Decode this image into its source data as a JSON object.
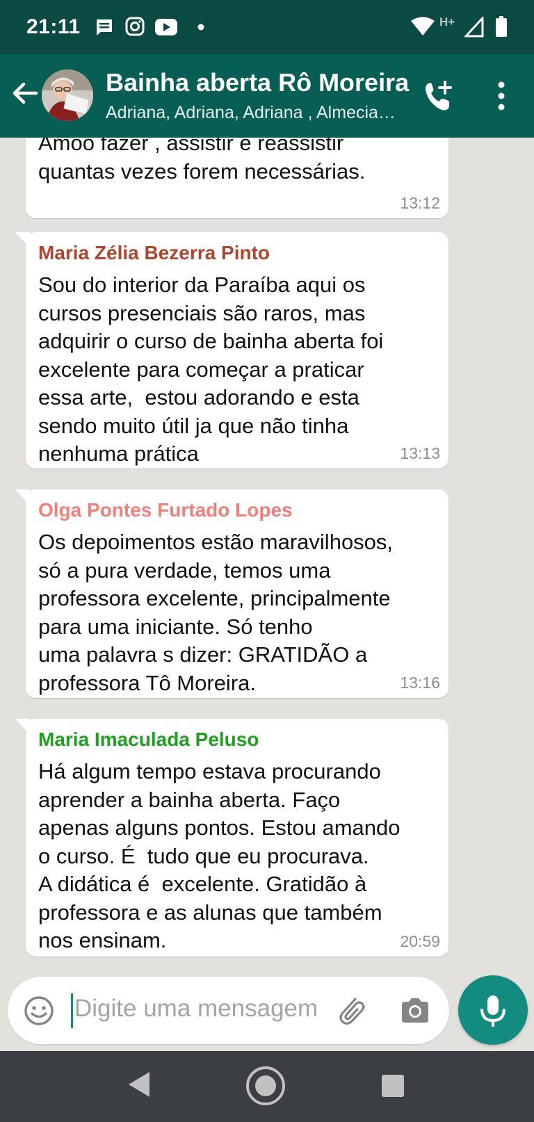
{
  "status_bar": {
    "time": "21:11",
    "network_label": "H+",
    "icons": [
      "message-notification-icon",
      "instagram-icon",
      "youtube-icon",
      "dot-icon",
      "wifi-icon",
      "signal-icon",
      "battery-icon"
    ]
  },
  "header": {
    "title": "Bainha aberta Rô Moreira",
    "subtitle": "Adriana, Adriana, Adriana , Almeciana, Ana",
    "icons": [
      "back-arrow-icon",
      "group-avatar",
      "add-call-icon",
      "more-vert-icon"
    ]
  },
  "messages": [
    {
      "sender": "",
      "sender_color": "",
      "text": "Amoo fazer , assistir e reassistir\nquantas vezes forem necessárias.",
      "time": "13:12"
    },
    {
      "sender": "Maria Zélia Bezerra Pinto",
      "sender_color": "#b0452e",
      "text": "Sou do interior da Paraíba aqui os\ncursos presenciais são raros, mas\nadquirir o curso de bainha aberta foi\nexcelente para começar a praticar\nessa arte,  estou adorando e esta\nsendo muito útil ja que não tinha\nnenhuma prática",
      "time": "13:13"
    },
    {
      "sender": "Olga Pontes Furtado Lopes",
      "sender_color": "#f2807a",
      "text": "Os depoimentos estão maravilhosos,\nsó a pura verdade, temos uma\nprofessora excelente, principalmente\npara uma iniciante. Só tenho\numa palavra s dizer: GRATIDÃO a\nprofessora Tô Moreira.",
      "time": "13:16"
    },
    {
      "sender": "Maria Imaculada Peluso",
      "sender_color": "#1ea21e",
      "text": "Há algum tempo estava procurando\naprender a bainha aberta. Faço\napenas alguns pontos. Estou amando\no curso. É  tudo que eu procurava.\nA didática é  excelente. Gratidão à\nprofessora e as alunas que também\nnos ensinam.",
      "time": "20:59"
    }
  ],
  "composer": {
    "placeholder": "Digite uma mensagem",
    "icons": [
      "emoji-icon",
      "attach-icon",
      "camera-icon",
      "microphone-icon"
    ]
  },
  "nav_bar": {
    "icons": [
      "nav-back-icon",
      "nav-home-icon",
      "nav-recents-icon"
    ]
  },
  "colors": {
    "status_bar": "#0a4a42",
    "app_bar": "#075e54",
    "accent": "#128c7e",
    "chat_background": "#e3e1de"
  }
}
